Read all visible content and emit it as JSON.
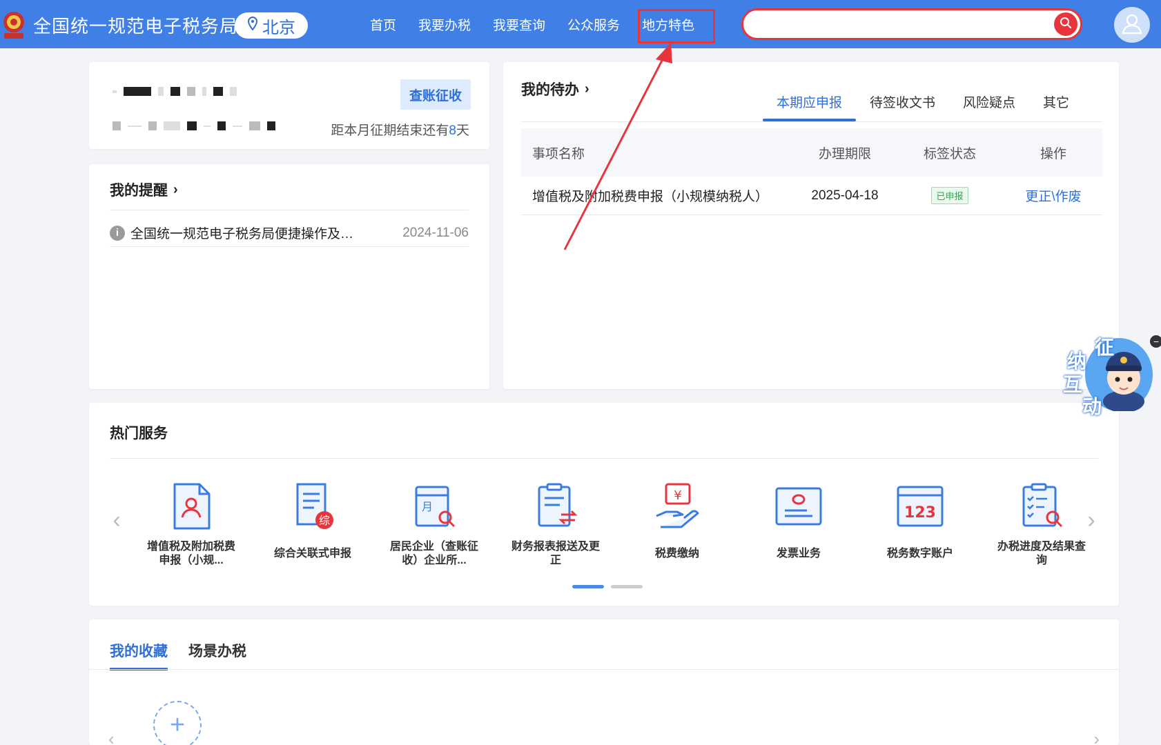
{
  "header": {
    "title": "全国统一规范电子税务局",
    "city": "北京",
    "nav": [
      "首页",
      "我要办税",
      "我要查询",
      "公众服务",
      "地方特色"
    ],
    "search_placeholder": "",
    "colors": {
      "bar": "#3f7fe6",
      "highlight": "#e8353d"
    }
  },
  "account": {
    "check_button": "查账征收",
    "deadline_prefix": "距本月征期结束还有",
    "deadline_days": "8",
    "deadline_suffix": "天"
  },
  "reminder": {
    "title": "我的提醒",
    "items": [
      {
        "text": "全国统一规范电子税务局便捷操作及…",
        "date": "2024-11-06"
      }
    ]
  },
  "todo": {
    "title": "我的待办",
    "tabs": [
      "本期应申报",
      "待签收文书",
      "风险疑点",
      "其它"
    ],
    "columns": [
      "事项名称",
      "办理期限",
      "标签状态",
      "操作"
    ],
    "rows": [
      {
        "name": "增值税及附加税费申报（小规模纳税人）",
        "deadline": "2025-04-18",
        "status": "已申报",
        "action": "更正\\作废"
      }
    ]
  },
  "hot": {
    "title": "热门服务",
    "services": [
      {
        "icon": "person-doc-icon",
        "label": "增值税及附加税费申报（小规..."
      },
      {
        "icon": "scroll-doc-icon",
        "label": "综合关联式申报"
      },
      {
        "icon": "calendar-search-icon",
        "label": "居民企业（查账征收）企业所..."
      },
      {
        "icon": "clipboard-exchange-icon",
        "label": "财务报表报送及更正"
      },
      {
        "icon": "hand-yuan-icon",
        "label": "税费缴纳"
      },
      {
        "icon": "invoice-card-icon",
        "label": "发票业务"
      },
      {
        "icon": "digital-account-icon",
        "label": "税务数字账户"
      },
      {
        "icon": "checklist-search-icon",
        "label": "办税进度及结果查询"
      }
    ],
    "page_count": 2,
    "active_page": 1
  },
  "favorites": {
    "tabs": [
      "我的收藏",
      "场景办税"
    ],
    "add_symbol": "+"
  },
  "assistant": {
    "chars": [
      "征",
      "纳",
      "互",
      "动"
    ]
  },
  "collapse_symbol": "−"
}
